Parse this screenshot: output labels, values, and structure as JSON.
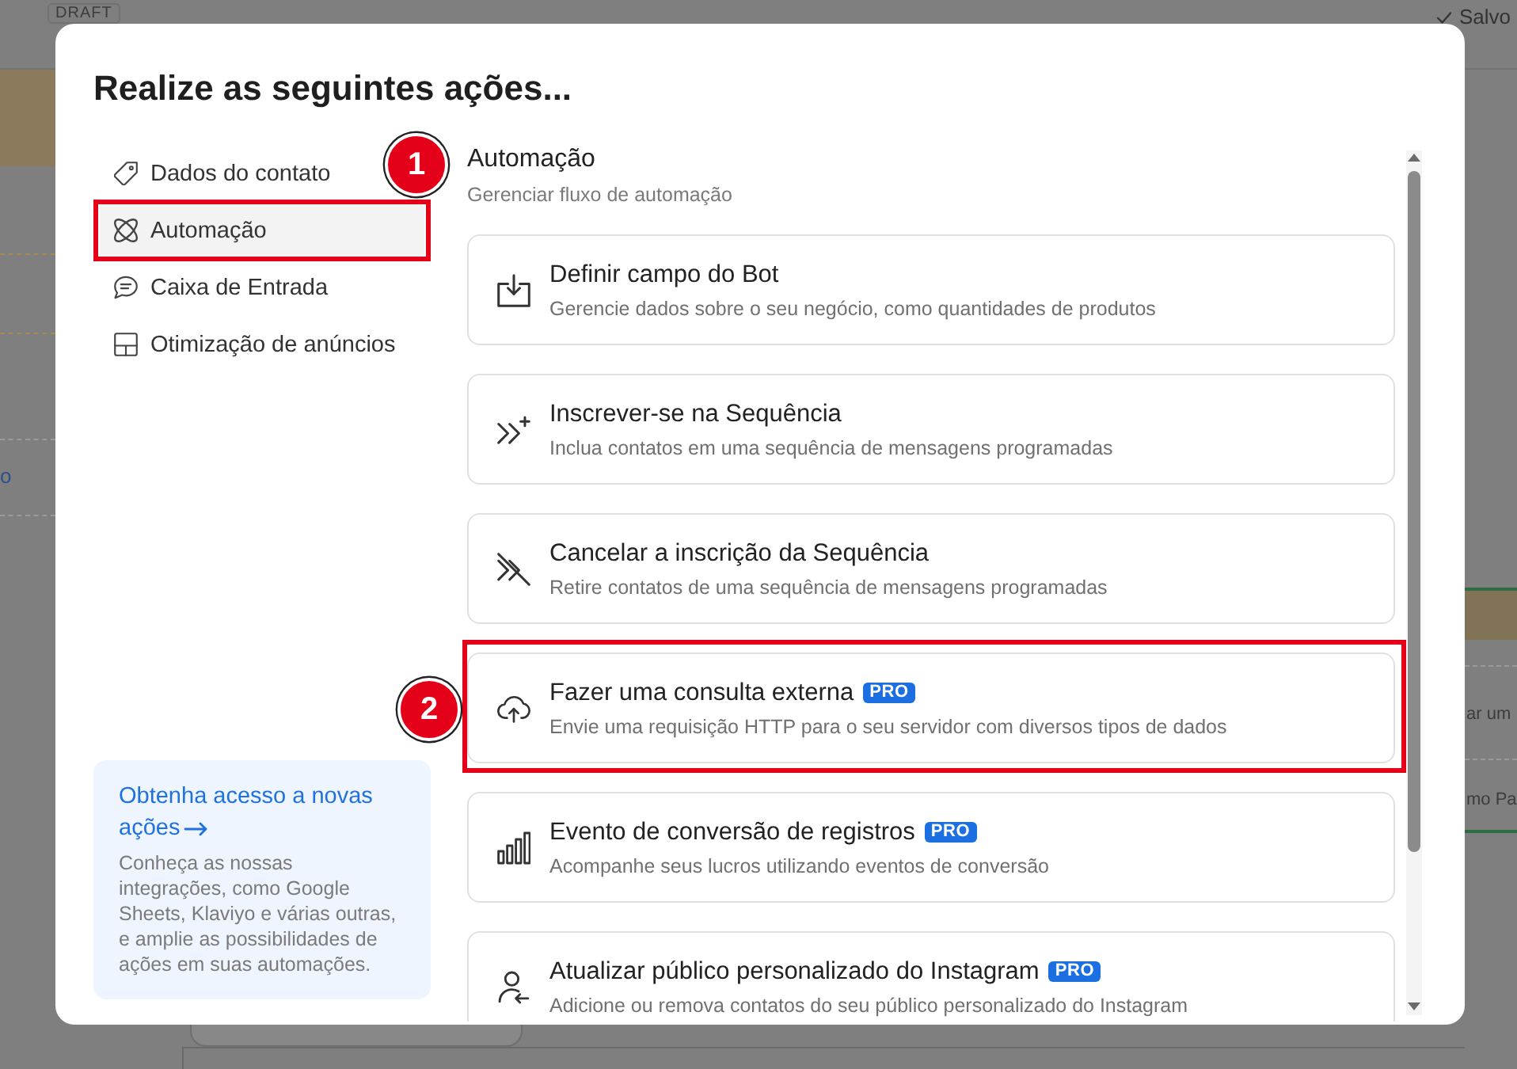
{
  "background": {
    "draft_badge": "DRAFT",
    "save_status": "Salvo",
    "left_fragment": "o",
    "right_fragments": [
      "ar um",
      "mo Pa"
    ]
  },
  "dialog": {
    "title": "Realize as seguintes ações...",
    "nav": [
      {
        "label": "Dados do contato",
        "selected": false,
        "highlighted": false
      },
      {
        "label": "Automação",
        "selected": true,
        "highlighted": true,
        "marker": "1"
      },
      {
        "label": "Caixa de Entrada",
        "selected": false,
        "highlighted": false
      },
      {
        "label": "Otimização de anúncios",
        "selected": false,
        "highlighted": false
      }
    ],
    "promo": {
      "link": "Obtenha acesso a novas ações",
      "text": "Conheça as nossas integrações, como Google Sheets, Klaviyo e várias outras, e amplie as possibilidades de ações em suas automações."
    },
    "section": {
      "title": "Automação",
      "subtitle": "Gerenciar fluxo de automação"
    },
    "actions": [
      {
        "title": "Definir campo do Bot",
        "description": "Gerencie dados sobre o seu negócio, como quantidades de produtos",
        "highlighted": false
      },
      {
        "title": "Inscrever-se na Sequência",
        "description": "Inclua contatos em uma sequência de mensagens programadas",
        "highlighted": false
      },
      {
        "title": "Cancelar a inscrição da Sequência",
        "description": "Retire contatos de uma sequência de mensagens programadas",
        "highlighted": false
      },
      {
        "title": "Fazer uma consulta externa",
        "badge": "PRO",
        "description": "Envie uma requisição HTTP para o seu servidor com diversos tipos de dados",
        "highlighted": true,
        "marker": "2"
      },
      {
        "title": "Evento de conversão de registros",
        "badge": "PRO",
        "description": "Acompanhe seus lucros utilizando eventos de conversão",
        "highlighted": false
      },
      {
        "title": "Atualizar público personalizado do Instagram",
        "badge": "PRO",
        "description": "Adicione ou remova contatos do seu público personalizado do Instagram",
        "highlighted": false
      }
    ]
  }
}
